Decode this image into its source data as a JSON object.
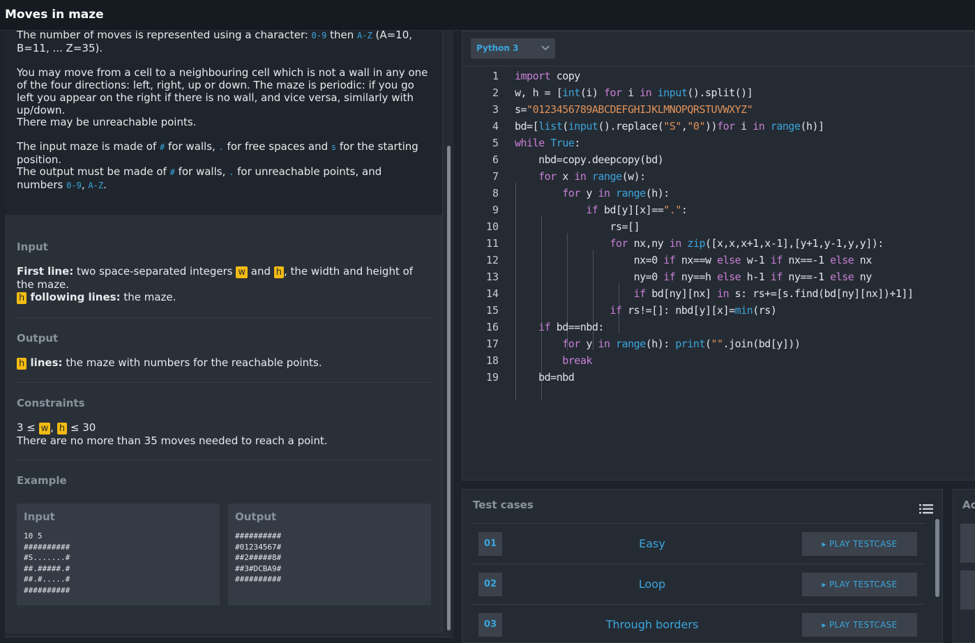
{
  "header": {
    "title": "Moves in maze"
  },
  "statement": {
    "para1": "The number of moves is represented using a character: ",
    "code_09": "0-9",
    "then": " then ",
    "code_az": "A-Z",
    "para1_end": " (A=10, B=11, ... Z=35).",
    "para2": "You may move from a cell to a neighbouring cell which is not a wall in any one of the four directions: left, right, up or down. The maze is periodic: if you go left you appear on the right if there is no wall, and vice versa, similarly with up/down.",
    "para3": "There may be unreachable points.",
    "para4_a": "The input maze is made of ",
    "hash": "#",
    "para4_b": " for walls, ",
    "dot": ".",
    "para4_c": " for free spaces and ",
    "s": "s",
    "para4_d": " for the starting position.",
    "para5_a": "The output must be made of ",
    "para5_b": " for walls, ",
    "para5_c": " for unreachable points, and numbers ",
    "comma": ", ",
    "period": "."
  },
  "input_section": {
    "heading": "Input",
    "first_line_label": "First line:",
    "first_line_a": " two space-separated integers ",
    "var_w": "w",
    "and": " and ",
    "var_h": "h",
    "first_line_b": ", the width and height of the maze.",
    "following_label": " following lines:",
    "following_text": " the maze."
  },
  "output_section": {
    "heading": "Output",
    "lines_label": " lines:",
    "lines_text": " the maze with numbers for the reachable points."
  },
  "constraints_section": {
    "heading": "Constraints",
    "c1_a": "3 ≤ ",
    "c1_sep": ", ",
    "c1_b": " ≤ 30",
    "c2": "There are no more than 35 moves needed to reach a point."
  },
  "example_section": {
    "heading": "Example",
    "input_label": "Input",
    "input_text": "10 5\n##########\n#S.......#\n##.#####.#\n##.#.....#\n##########",
    "output_label": "Output",
    "output_text": "##########\n#01234567#\n##2#####8#\n##3#DCBA9#\n##########"
  },
  "editor": {
    "language": "Python 3",
    "line_numbers": [
      "1",
      "2",
      "3",
      "4",
      "5",
      "6",
      "7",
      "8",
      "9",
      "10",
      "11",
      "12",
      "13",
      "14",
      "15",
      "16",
      "17",
      "18",
      "19"
    ]
  },
  "tests": {
    "heading": "Test cases",
    "cases": [
      {
        "num": "01",
        "name": "Easy",
        "action": "PLAY TESTCASE"
      },
      {
        "num": "02",
        "name": "Loop",
        "action": "PLAY TESTCASE"
      },
      {
        "num": "03",
        "name": "Through borders",
        "action": "PLAY TESTCASE"
      }
    ]
  },
  "actions": {
    "heading": "Ac"
  },
  "colors": {
    "accent": "#3aa6dd",
    "highlight": "#f2bb13",
    "keyword": "#c97fd6",
    "string": "#e0925a"
  }
}
